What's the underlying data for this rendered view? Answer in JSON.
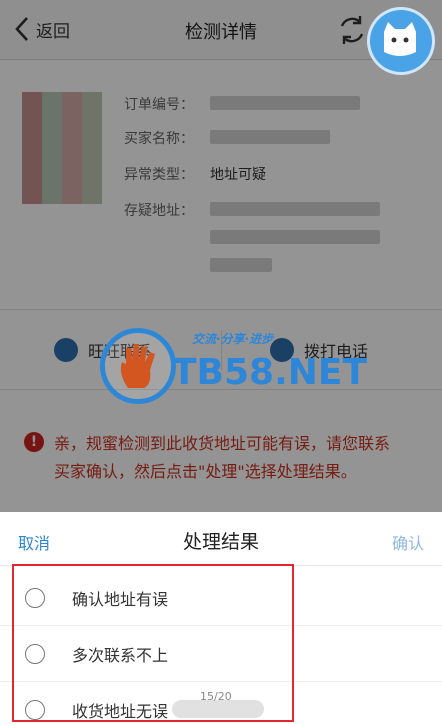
{
  "nav": {
    "back_label": "返回",
    "title": "检测详情"
  },
  "order": {
    "fields": [
      {
        "label": "订单编号：",
        "value": ""
      },
      {
        "label": "买家名称：",
        "value": ""
      },
      {
        "label": "异常类型：",
        "value": "地址可疑"
      },
      {
        "label": "存疑地址：",
        "value": ""
      }
    ]
  },
  "actions": {
    "left_label": "旺旺联系",
    "right_label": "拨打电话"
  },
  "warning": {
    "text": "亲，规蜜检测到此收货地址可能有误，请您联系买家确认，然后点击\"处理\"选择处理结果。"
  },
  "watermark": {
    "brand": "TB58.NET",
    "slogan": "交流·分享·进步"
  },
  "sheet": {
    "cancel": "取消",
    "title": "处理结果",
    "confirm": "确认",
    "options": [
      {
        "label": "确认地址有误"
      },
      {
        "label": "多次联系不上"
      },
      {
        "label": "收货地址无误"
      }
    ]
  },
  "page_counter": "15/20",
  "colors": {
    "accent_blue": "#2d87d6",
    "warning_red": "#cc3322",
    "highlight_red": "#e3262f"
  }
}
